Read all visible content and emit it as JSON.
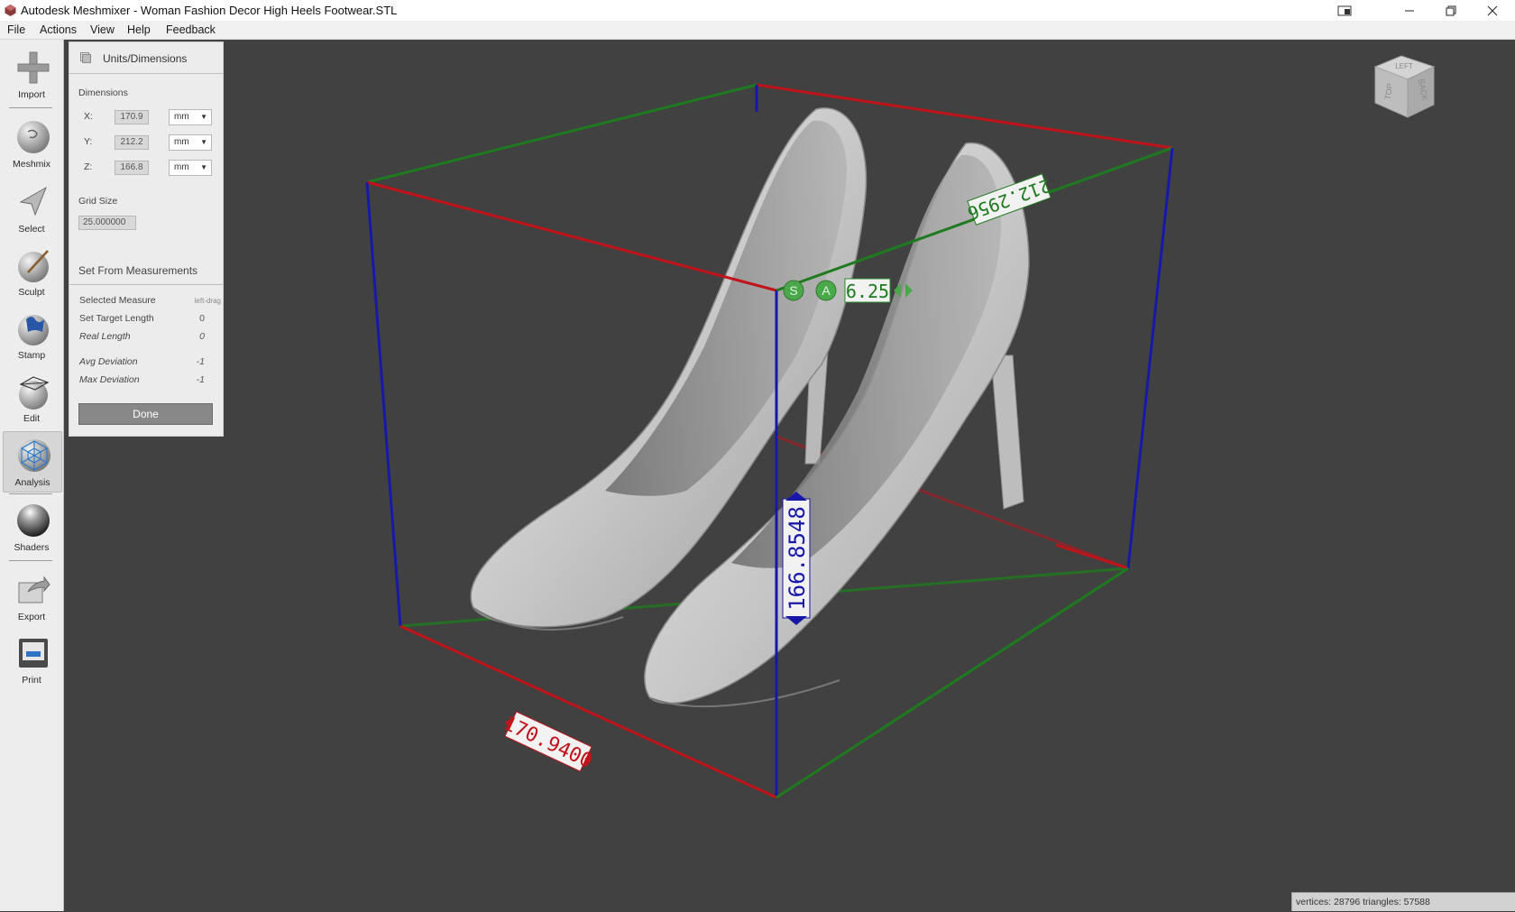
{
  "window": {
    "title": "Autodesk Meshmixer - Woman Fashion Decor High Heels Footwear.STL"
  },
  "menu": [
    "File",
    "Actions",
    "View",
    "Help",
    "Feedback"
  ],
  "toolbar": {
    "tools": [
      {
        "label": "Import",
        "icon": "import-icon"
      },
      {
        "label": "Meshmix",
        "icon": "meshmix-icon"
      },
      {
        "label": "Select",
        "icon": "select-icon"
      },
      {
        "label": "Sculpt",
        "icon": "sculpt-icon"
      },
      {
        "label": "Stamp",
        "icon": "stamp-icon"
      },
      {
        "label": "Edit",
        "icon": "edit-icon"
      },
      {
        "label": "Analysis",
        "icon": "analysis-icon",
        "active": true
      },
      {
        "label": "Shaders",
        "icon": "shaders-icon"
      },
      {
        "label": "Export",
        "icon": "export-icon"
      },
      {
        "label": "Print",
        "icon": "print-icon"
      }
    ]
  },
  "panel": {
    "title": "Units/Dimensions",
    "dimensions_label": "Dimensions",
    "dims": [
      {
        "axis": "X:",
        "value": "170.9",
        "unit": "mm"
      },
      {
        "axis": "Y:",
        "value": "212.2",
        "unit": "mm"
      },
      {
        "axis": "Z:",
        "value": "166.8",
        "unit": "mm"
      }
    ],
    "grid_size_label": "Grid Size",
    "grid_size_value": "25.000000",
    "set_from_measurements": "Set From Measurements",
    "rows": [
      {
        "label": "Selected Measure",
        "value": "left-drag"
      },
      {
        "label": "Set Target Length",
        "value": "0"
      },
      {
        "label": "Real Length",
        "value": "0"
      },
      {
        "label": "Avg Deviation",
        "value": "-1"
      },
      {
        "label": "Max Deviation",
        "value": "-1"
      }
    ],
    "done": "Done"
  },
  "viewport": {
    "labels": {
      "x_length": "170.9400",
      "y_length": "212.2956",
      "z_length": "166.8548",
      "grid": "6.25",
      "grid_s": "S",
      "grid_a": "A"
    },
    "view_cube": {
      "top": "TOP",
      "back": "BACK",
      "left": "LEFT"
    },
    "colors": {
      "x_axis": "#c0141a",
      "y_axis": "#1e7a1e",
      "z_axis": "#1818a8",
      "background": "#414141"
    },
    "status": "vertices: 28796 triangles: 57588"
  }
}
